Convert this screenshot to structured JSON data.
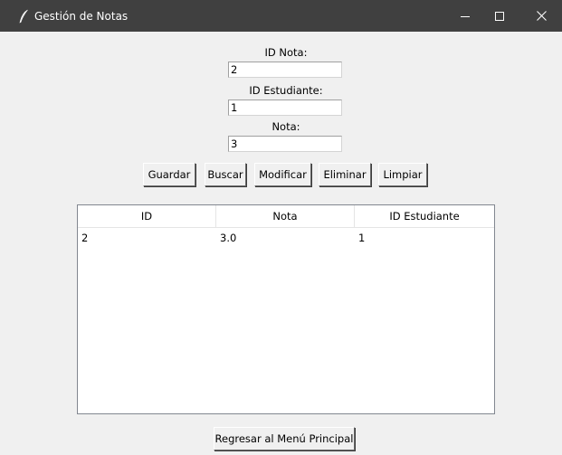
{
  "window": {
    "title": "Gestión de Notas",
    "icon": "feather-icon",
    "controls": [
      "minimize-icon",
      "maximize-icon",
      "close-icon"
    ]
  },
  "form": {
    "id_nota_label": "ID Nota:",
    "id_nota_value": "2",
    "id_estudiante_label": "ID Estudiante:",
    "id_estudiante_value": "1",
    "nota_label": "Nota:",
    "nota_value": "3"
  },
  "buttons": {
    "guardar": "Guardar",
    "buscar": "Buscar",
    "modificar": "Modificar",
    "eliminar": "Eliminar",
    "limpiar": "Limpiar",
    "regresar": "Regresar al Menú Principal"
  },
  "table": {
    "columns": [
      "ID",
      "Nota",
      "ID Estudiante"
    ],
    "rows": [
      [
        "2",
        "3.0",
        "1"
      ]
    ]
  },
  "colors": {
    "titlebar": "#404040",
    "window_bg": "#f0f0f0",
    "table_bg": "#ffffff"
  }
}
